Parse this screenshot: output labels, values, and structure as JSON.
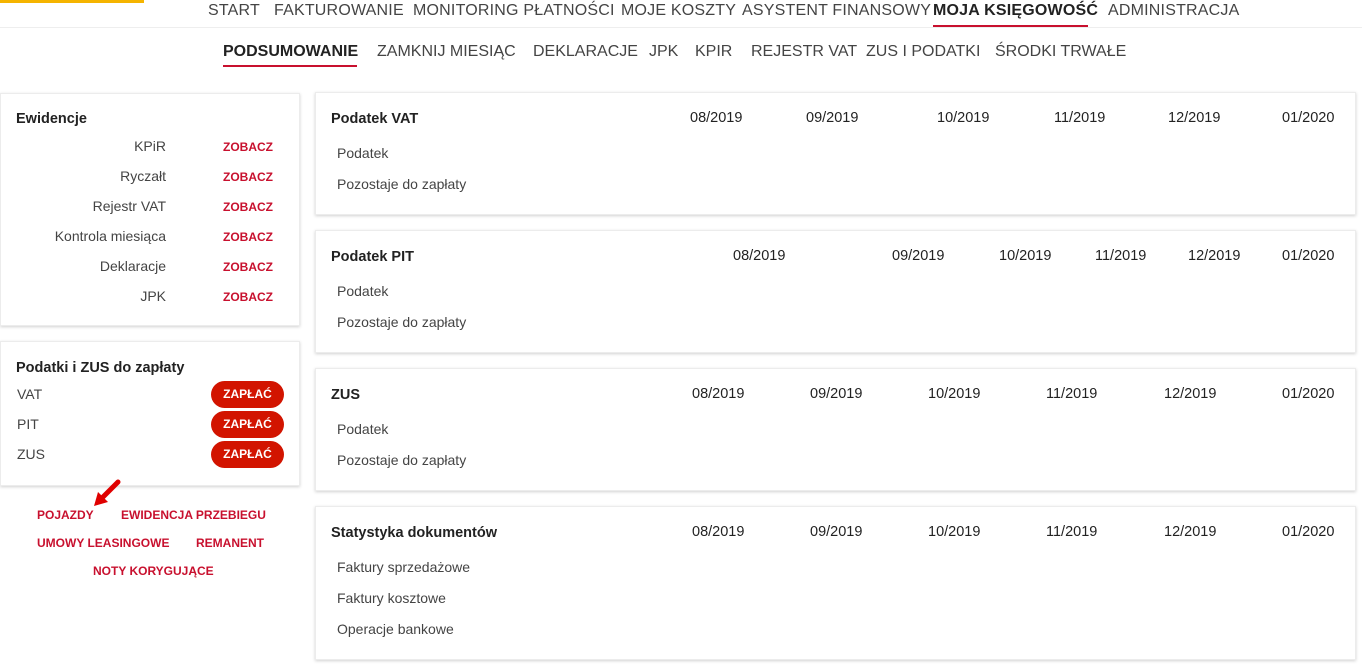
{
  "main_nav": {
    "items": [
      "START",
      "FAKTUROWANIE",
      "MONITORING PŁATNOŚCI",
      "MOJE KOSZTY",
      "ASYSTENT FINANSOWY",
      "MOJA KSIĘGOWOŚĆ",
      "ADMINISTRACJA"
    ],
    "active": "MOJA KSIĘGOWOŚĆ"
  },
  "sub_nav": {
    "items": [
      "PODSUMOWANIE",
      "ZAMKNIJ MIESIĄC",
      "DEKLARACJE",
      "JPK",
      "KPIR",
      "REJESTR VAT",
      "ZUS I PODATKI",
      "ŚRODKI TRWAŁE"
    ],
    "active": "PODSUMOWANIE"
  },
  "ewidencje": {
    "title": "Ewidencje",
    "rows": [
      {
        "label": "KPiR",
        "link": "ZOBACZ"
      },
      {
        "label": "Ryczałt",
        "link": "ZOBACZ"
      },
      {
        "label": "Rejestr VAT",
        "link": "ZOBACZ"
      },
      {
        "label": "Kontrola miesiąca",
        "link": "ZOBACZ"
      },
      {
        "label": "Deklaracje",
        "link": "ZOBACZ"
      },
      {
        "label": "JPK",
        "link": "ZOBACZ"
      }
    ]
  },
  "podatki": {
    "title": "Podatki i ZUS do zapłaty",
    "rows": [
      {
        "label": "VAT",
        "button": "ZAPŁAĆ"
      },
      {
        "label": "PIT",
        "button": "ZAPŁAĆ"
      },
      {
        "label": "ZUS",
        "button": "ZAPŁAĆ"
      }
    ]
  },
  "links": [
    "POJAZDY",
    "EWIDENCJA PRZEBIEGU",
    "UMOWY LEASINGOWE",
    "REMANENT",
    "NOTY KORYGUJĄCE"
  ],
  "panels": [
    {
      "title": "Podatek VAT",
      "periods": [
        "08/2019",
        "09/2019",
        "10/2019",
        "11/2019",
        "12/2019",
        "01/2020"
      ],
      "rows": [
        "Podatek",
        "Pozostaje do zapłaty"
      ]
    },
    {
      "title": "Podatek PIT",
      "periods": [
        "08/2019",
        "09/2019",
        "10/2019",
        "11/2019",
        "12/2019",
        "01/2020"
      ],
      "rows": [
        "Podatek",
        "Pozostaje do zapłaty"
      ]
    },
    {
      "title": "ZUS",
      "periods": [
        "08/2019",
        "09/2019",
        "10/2019",
        "11/2019",
        "12/2019",
        "01/2020"
      ],
      "rows": [
        "Podatek",
        "Pozostaje do zapłaty"
      ]
    },
    {
      "title": "Statystyka dokumentów",
      "periods": [
        "08/2019",
        "09/2019",
        "10/2019",
        "11/2019",
        "12/2019",
        "01/2020"
      ],
      "rows": [
        "Faktury sprzedażowe",
        "Faktury kosztowe",
        "Operacje bankowe"
      ]
    }
  ],
  "colors": {
    "accent": "#c8102e",
    "button": "#d21400",
    "brand": "#f5b400"
  },
  "icons": {
    "annotation": "arrow-icon"
  }
}
